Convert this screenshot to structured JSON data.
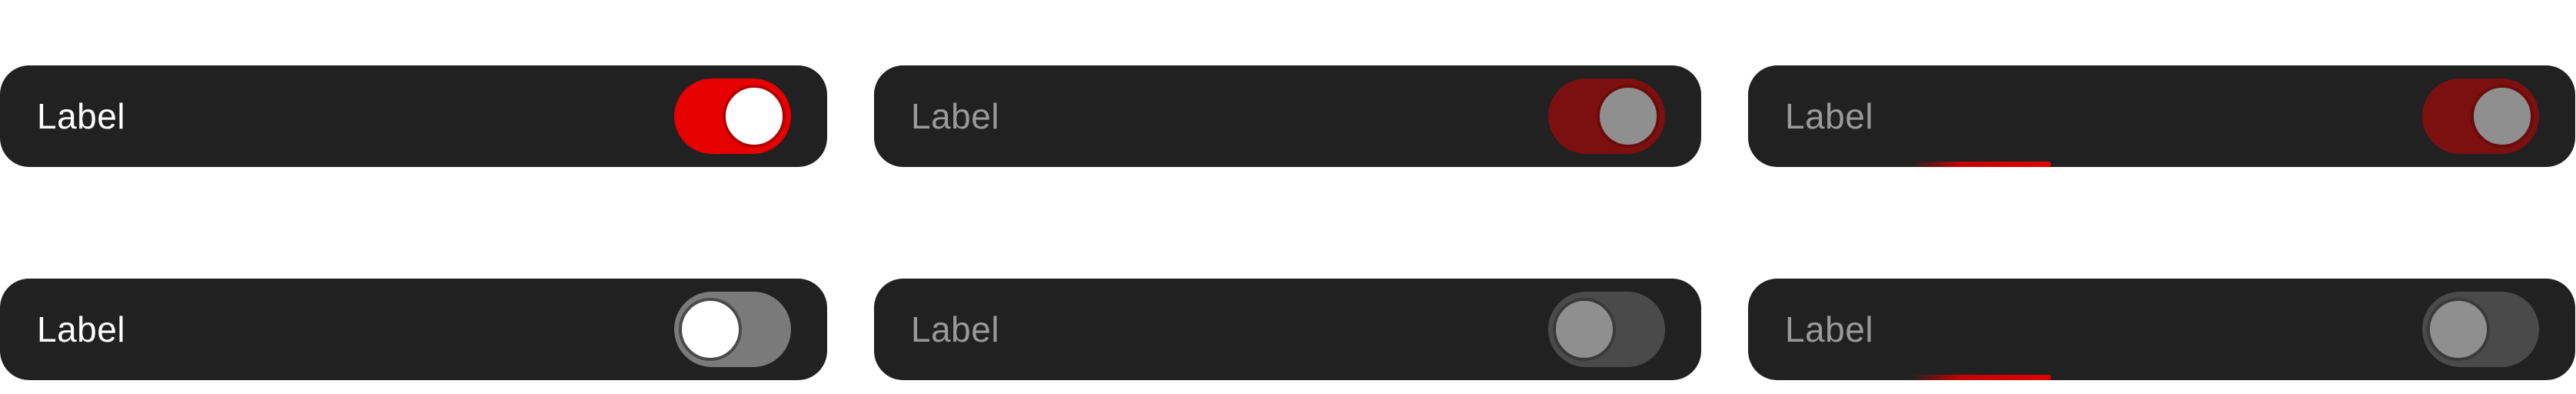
{
  "toggles": [
    {
      "label": "Label",
      "state": "on",
      "variant": "enabled"
    },
    {
      "label": "Label",
      "state": "on",
      "variant": "disabled"
    },
    {
      "label": "Label",
      "state": "on",
      "variant": "focused"
    },
    {
      "label": "Label",
      "state": "off",
      "variant": "enabled"
    },
    {
      "label": "Label",
      "state": "off",
      "variant": "disabled"
    },
    {
      "label": "Label",
      "state": "off",
      "variant": "focused"
    }
  ],
  "colors": {
    "cell_bg": "#212121",
    "accent_on": "#e60000",
    "accent_on_dim": "#7c1010",
    "track_off": "#7a7a7a",
    "track_off_dim": "#4a4a4a",
    "label_active": "#ffffff",
    "label_dim": "#9a9a9a"
  }
}
